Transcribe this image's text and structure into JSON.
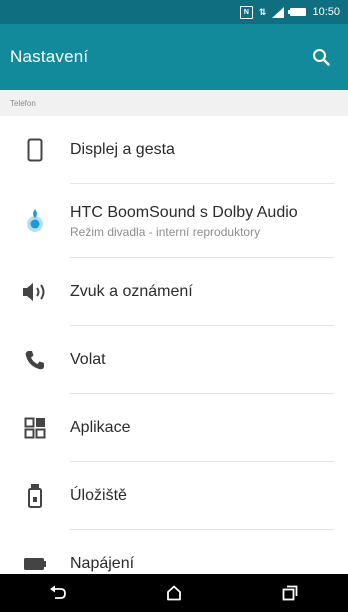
{
  "status_bar": {
    "time": "10:50",
    "icons": [
      "nfc-icon",
      "data-icon",
      "signal-icon",
      "battery-icon"
    ]
  },
  "app_bar": {
    "title": "Nastavení",
    "search_icon": "search-icon"
  },
  "section": {
    "header": "Telefon"
  },
  "items": [
    {
      "label": "Displej a gesta",
      "icon": "display-icon"
    },
    {
      "label": "HTC BoomSound s Dolby Audio",
      "sublabel": "Režim divadla - interní reproduktory",
      "icon": "boomsound-icon"
    },
    {
      "label": "Zvuk a oznámení",
      "icon": "speaker-icon"
    },
    {
      "label": "Volat",
      "icon": "phone-icon"
    },
    {
      "label": "Aplikace",
      "icon": "apps-icon"
    },
    {
      "label": "Úložiště",
      "icon": "storage-icon"
    },
    {
      "label": "Napájení",
      "icon": "power-icon"
    }
  ],
  "nav_bar": {
    "buttons": [
      "back-icon",
      "home-icon",
      "recent-apps-icon"
    ]
  },
  "colors": {
    "status_bar": "#0f6f80",
    "app_bar": "#138a9b",
    "accent": "#1a9bd7"
  }
}
